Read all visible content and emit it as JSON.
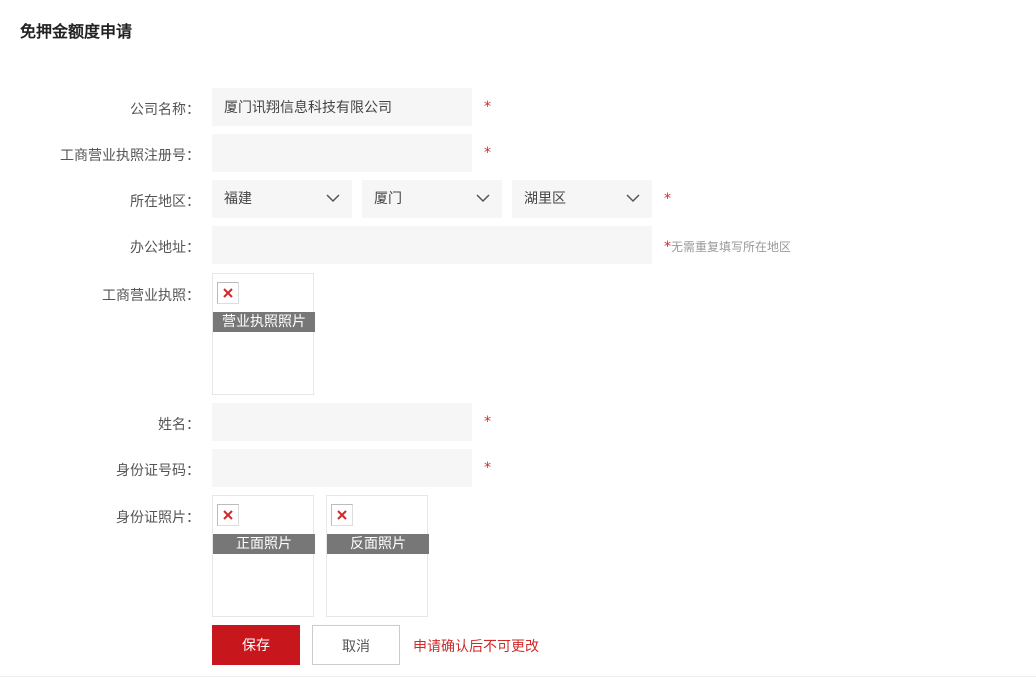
{
  "page": {
    "title": "免押金额度申请"
  },
  "form": {
    "company": {
      "label": "公司名称：",
      "value": "厦门讯翔信息科技有限公司",
      "required_mark": "*"
    },
    "reg_no": {
      "label": "工商营业执照注册号：",
      "value": "",
      "required_mark": "*"
    },
    "region": {
      "label": "所在地区：",
      "province": "福建",
      "city": "厦门",
      "district": "湖里区",
      "required_mark": "*"
    },
    "address": {
      "label": "办公地址：",
      "value": "",
      "hint_star": "*",
      "hint": "无需重复填写所在地区"
    },
    "license": {
      "label": "工商营业执照：",
      "caption": "营业执照照片"
    },
    "name": {
      "label": "姓名：",
      "value": "",
      "required_mark": "*"
    },
    "id_no": {
      "label": "身份证号码：",
      "value": "",
      "required_mark": "*"
    },
    "id_photo": {
      "label": "身份证照片：",
      "front_caption": "正面照片",
      "back_caption": "反面照片"
    }
  },
  "actions": {
    "save_label": "保存",
    "cancel_label": "取消",
    "note": "申请确认后不可更改"
  },
  "colors": {
    "accent": "#c8161d",
    "required": "#d12a2a",
    "input_bg": "#f6f6f6",
    "caption_bg": "#777777"
  },
  "icons": {
    "dropdown": "chevron-down-icon",
    "broken_image": "broken-image-icon"
  }
}
